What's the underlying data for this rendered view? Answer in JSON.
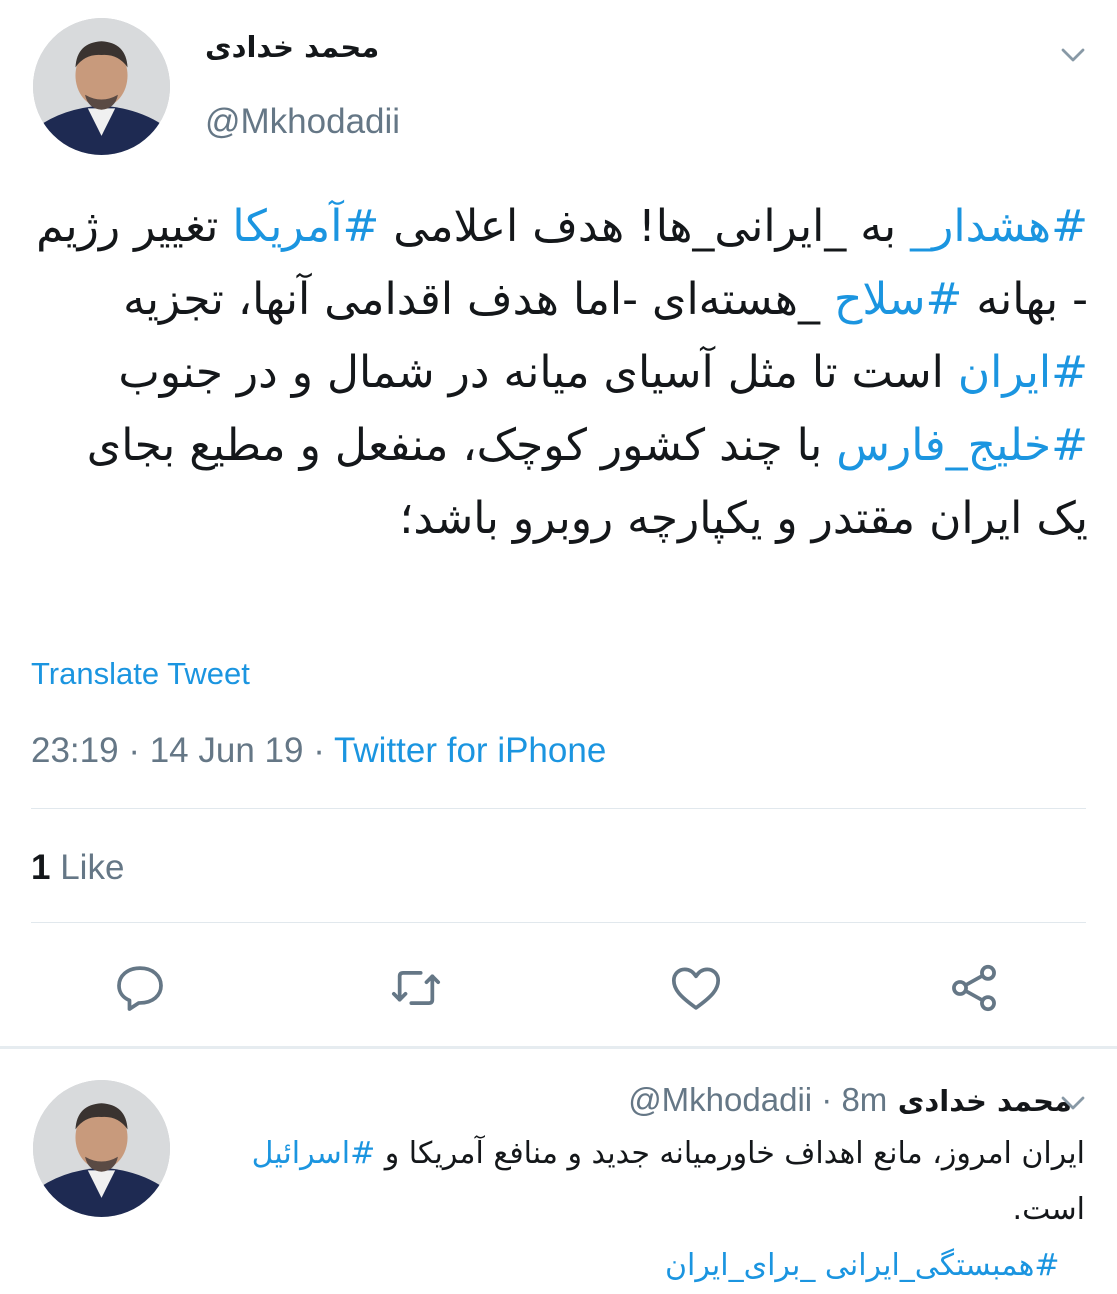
{
  "main_tweet": {
    "author_name": "محمد خدادی",
    "author_handle": "@Mkhodadii",
    "text": [
      {
        "t": "#هشدار_",
        "tag": true
      },
      {
        "t": " به _ایرانی_ها! هدف اعلامی ",
        "tag": false
      },
      {
        "t": "#آمریکا",
        "tag": true
      },
      {
        "t": " تغییر رژیم - بهانه ",
        "tag": false
      },
      {
        "t": "#سلاح",
        "tag": true
      },
      {
        "t": " _هسته‌ای -اما هدف اقدامی آنها، تجزیه ",
        "tag": false
      },
      {
        "t": "#ایران",
        "tag": true
      },
      {
        "t": " است تا مثل آسیای میانه در شمال و در جنوب ",
        "tag": false
      },
      {
        "t": "#خلیج_فارس",
        "tag": true
      },
      {
        "t": " با چند کشور کوچک، منفعل و مطیع بجای یک ایران مقتدر و یکپارچه روبرو باشد؛",
        "tag": false
      }
    ],
    "translate_label": "Translate Tweet",
    "time": "23:19",
    "date": "14 Jun 19",
    "separator": "·",
    "source": "Twitter for iPhone",
    "like_count": "1",
    "like_label": "Like",
    "actions": [
      "reply-icon",
      "retweet-icon",
      "like-icon",
      "share-icon"
    ]
  },
  "reply_tweet": {
    "author_name": "محمد خدادی",
    "author_handle": "@Mkhodadii",
    "time_ago": "8m",
    "separator": "·",
    "text": [
      {
        "t": "ایران امروز، مانع اهداف خاورمیانه جدید و منافع آمریکا و ",
        "tag": false
      },
      {
        "t": "#اسرائیل",
        "tag": true
      },
      {
        "t": " است.",
        "tag": false
      }
    ],
    "tags_line": "#همبستگی_ایرانی _برای_ایران"
  },
  "colors": {
    "link": "#1b95e0",
    "secondary": "#657786",
    "text": "#14171a",
    "divider": "#e1e8ed"
  }
}
